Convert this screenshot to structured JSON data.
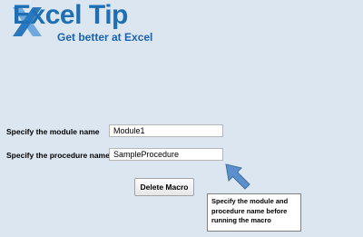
{
  "logo": {
    "brand_first": "Excel",
    "brand_second": "Tip",
    "tagline": "Get better at Excel"
  },
  "form": {
    "module": {
      "label": "Specify the module name",
      "value": "Module1"
    },
    "procedure": {
      "label": "Specify the procedure name",
      "value": "SampleProcedure"
    },
    "delete_button": "Delete Macro"
  },
  "note": {
    "text": "Specify the module and procedure name before running the macro"
  },
  "colors": {
    "background": "#dbe6f1",
    "brand_blue": "#1f6fb4",
    "arrow": "#5b8fce"
  }
}
